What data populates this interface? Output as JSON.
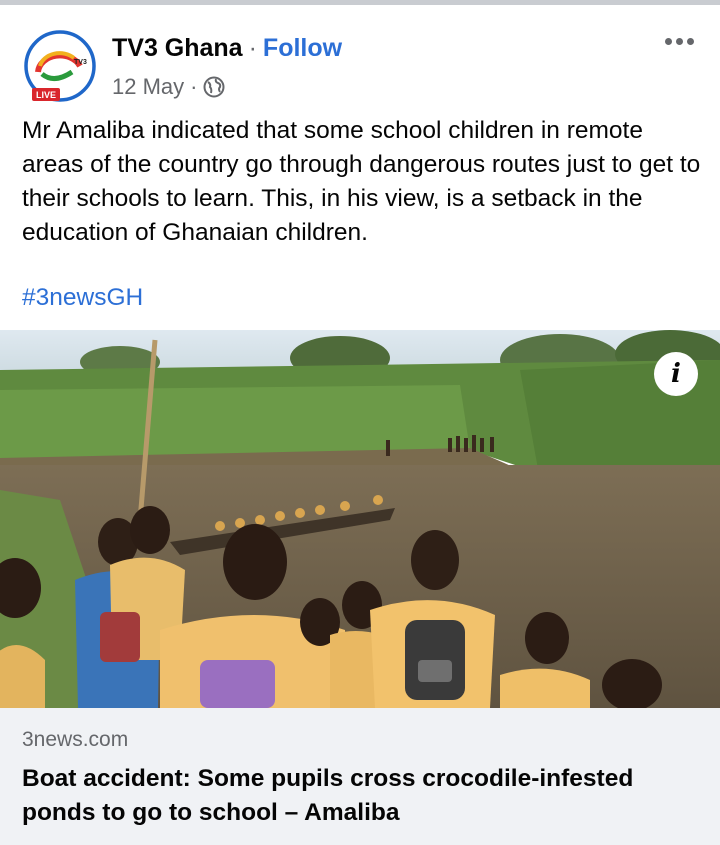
{
  "post": {
    "page_name": "TV3 Ghana",
    "separator": "·",
    "follow_label": "Follow",
    "date": "12 May",
    "meta_separator": "·",
    "audience_icon": "globe-icon",
    "avatar_badge": "LIVE",
    "avatar_logo_text": "TV3",
    "more_icon": "more-options-icon",
    "text": "Mr Amaliba indicated that some school children in remote areas of the country go through dangerous routes just to get to their schools to learn. This, in his view, is a setback in the education of Ghanaian children.",
    "hashtag": "#3newsGH"
  },
  "photo": {
    "info_label": "i"
  },
  "link_preview": {
    "domain": "3news.com",
    "title": "Boat accident: Some pupils cross crocodile-infested ponds to go to school – Amaliba"
  },
  "colors": {
    "accent": "#2c6fd6",
    "muted": "#65676b",
    "link_bg": "#f0f2f5",
    "live_badge": "#d9262c"
  }
}
